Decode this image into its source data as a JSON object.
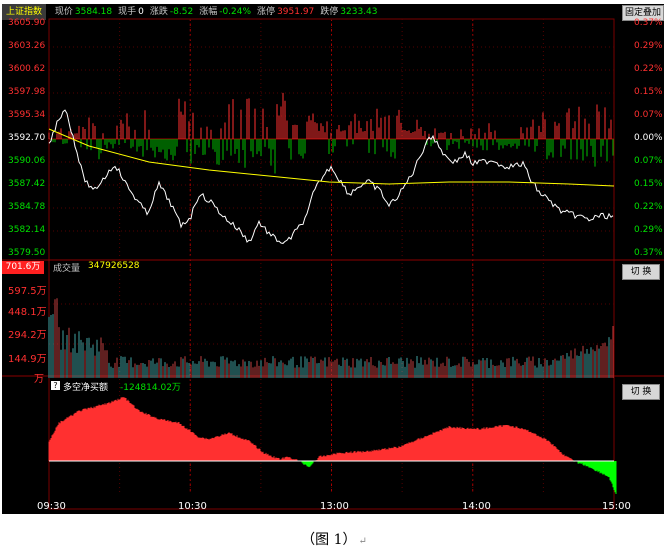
{
  "header": {
    "title": "上证指数",
    "fields": [
      {
        "label": "现价",
        "value": "3584.18",
        "color": "#00e000"
      },
      {
        "label": "现手",
        "value": "0",
        "color": "#ffffff"
      },
      {
        "label": "涨跌",
        "value": "-8.52",
        "color": "#00e000"
      },
      {
        "label": "涨幅",
        "value": "-0.24%",
        "color": "#00e000"
      },
      {
        "label": "涨停",
        "value": "3951.97",
        "color": "#ff3030"
      },
      {
        "label": "跌停",
        "value": "3233.43",
        "color": "#00e000"
      }
    ],
    "right_button": "固定叠加"
  },
  "price_axis": {
    "left": [
      "3605.90",
      "3603.26",
      "3600.62",
      "3597.98",
      "3595.34",
      "3592.70",
      "3590.06",
      "3587.42",
      "3584.78",
      "3582.14",
      "3579.50"
    ],
    "right": [
      "0.37%",
      "0.29%",
      "0.22%",
      "0.15%",
      "0.07%",
      "0.00%",
      "0.07%",
      "0.15%",
      "0.22%",
      "0.29%",
      "0.37%"
    ]
  },
  "volume_panel": {
    "current_value": "701.6万",
    "label": "成交量",
    "value": "347926528",
    "axis": [
      "597.5万",
      "448.1万",
      "294.2万",
      "144.9万",
      "万"
    ],
    "switch_button": "切 换"
  },
  "net_panel": {
    "help_icon": "?",
    "label": "多空净买额",
    "value": "-124814.02万",
    "switch_button": "切 换"
  },
  "time_axis": [
    "09:30",
    "10:30",
    "13:00",
    "14:00",
    "15:00"
  ],
  "caption": "（图 1）",
  "colors": {
    "up": "#ff3030",
    "down": "#00c000",
    "price_line": "#ffffff",
    "avg_line": "#ffff00",
    "grid": "#8b0000",
    "volume": "#3fa0a0"
  },
  "chart_data": {
    "type": "line",
    "x": [
      "09:30",
      "10:30",
      "13:00",
      "14:00",
      "15:00"
    ],
    "series": [],
    "ylim": [
      3579.5,
      3605.9
    ]
  }
}
